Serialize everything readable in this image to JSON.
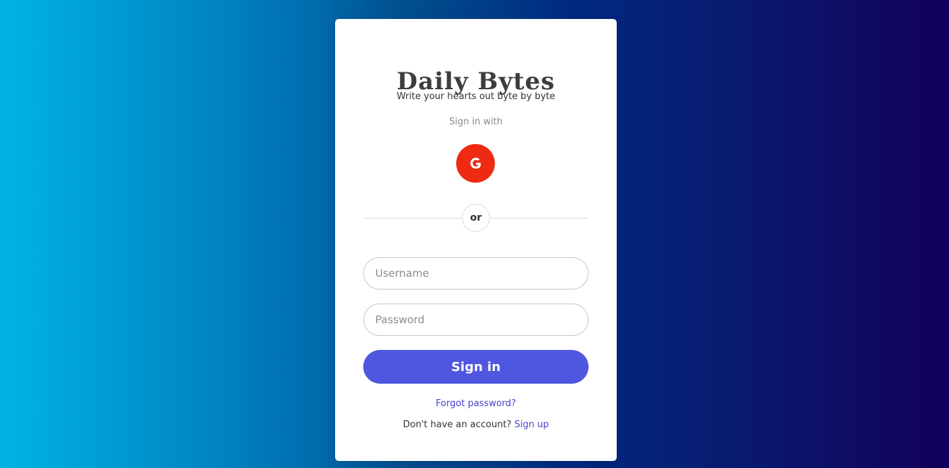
{
  "login": {
    "title": "Daily Bytes",
    "subtitle": "Write your hearts out byte by byte",
    "sign_in_with": "Sign in with",
    "google_button_letter": "G",
    "divider_text": "or",
    "username_placeholder": "Username",
    "password_placeholder": "Password",
    "sign_in_label": "Sign in",
    "forgot_password": "Forgot password?",
    "no_account_text": "Don't have an account?",
    "sign_up_link": "Sign up"
  },
  "colors": {
    "google_red": "#ee2a12",
    "accent_button": "#4f56df",
    "link": "#4444cc"
  },
  "icons": {
    "google": "google-icon"
  }
}
